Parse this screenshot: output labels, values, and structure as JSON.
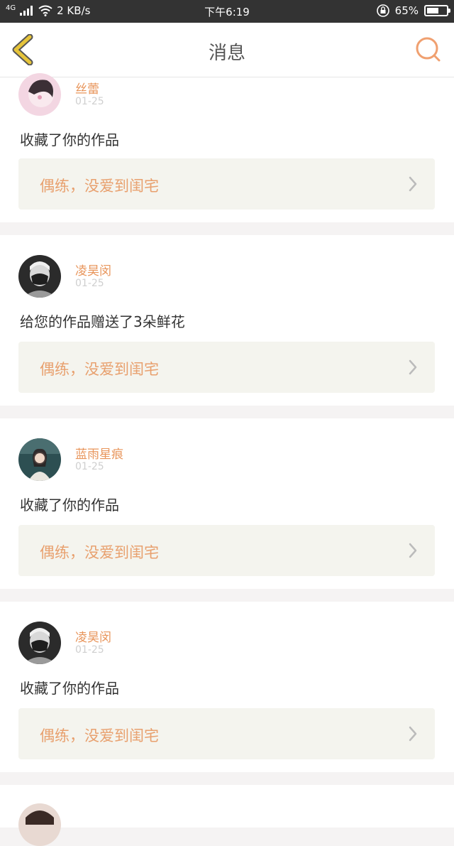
{
  "status_bar": {
    "network": "4G",
    "speed": "2 KB/s",
    "time": "下午6:19",
    "battery": "65%",
    "battery_level": 0.65
  },
  "header": {
    "title": "消息",
    "back_icon": "chevron-left-icon",
    "search_icon": "search-icon"
  },
  "colors": {
    "accent": "#e8955b",
    "back_icon": "#e6c43a",
    "card_bg": "#f4f4ee"
  },
  "messages": [
    {
      "name": "丝蕾",
      "date": "01-25",
      "action": "收藏了你的作品",
      "work": "偶练，没爱到闺宅"
    },
    {
      "name": "凌昊闵",
      "date": "01-25",
      "action": "给您的作品赠送了3朵鲜花",
      "work": "偶练，没爱到闺宅"
    },
    {
      "name": "蓝雨星痕",
      "date": "01-25",
      "action": "收藏了你的作品",
      "work": "偶练，没爱到闺宅"
    },
    {
      "name": "凌昊闵",
      "date": "01-25",
      "action": "收藏了你的作品",
      "work": "偶练，没爱到闺宅"
    }
  ]
}
